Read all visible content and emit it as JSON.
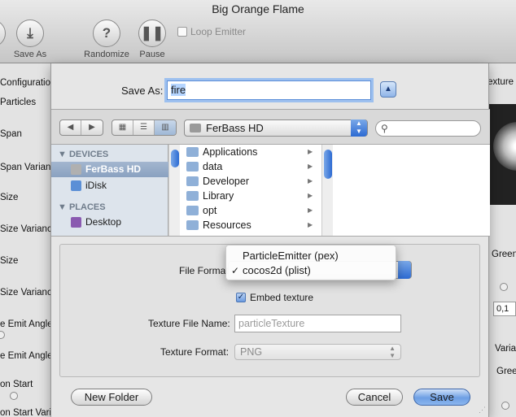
{
  "window": {
    "title": "Big Orange Flame"
  },
  "toolbar": {
    "save_as": "Save As",
    "randomize": "Randomize",
    "pause": "Pause",
    "loop_emitter": "Loop Emitter"
  },
  "background": {
    "left_labels": [
      "Configuration",
      "Particles",
      "Span",
      "Span Variance",
      "Size",
      "Size Variance",
      "Size",
      "Size Variance",
      "e Emit Angle",
      "e Emit Angle",
      "on Start",
      "on Start Varia"
    ],
    "right_labels": {
      "texture": "Particle Texture",
      "green_top": "Green",
      "value": "0,1",
      "variance": "Variance",
      "green_bottom": "Green"
    }
  },
  "sheet": {
    "save_as_label": "Save As:",
    "filename": "fire",
    "location": "FerBass HD",
    "sidebar": {
      "devices_heading": "DEVICES",
      "places_heading": "PLACES",
      "items": [
        {
          "label": "FerBass HD",
          "icon": "hard-drive-icon",
          "selected": true
        },
        {
          "label": "iDisk",
          "icon": "idisk-icon",
          "selected": false
        },
        {
          "label": "Desktop",
          "icon": "desktop-icon",
          "selected": false
        }
      ]
    },
    "files": [
      {
        "name": "Applications",
        "icon": "applications-folder-icon"
      },
      {
        "name": "data",
        "icon": "folder-icon"
      },
      {
        "name": "Developer",
        "icon": "developer-folder-icon"
      },
      {
        "name": "Library",
        "icon": "library-folder-icon"
      },
      {
        "name": "opt",
        "icon": "folder-icon"
      },
      {
        "name": "Resources",
        "icon": "folder-icon"
      }
    ],
    "options": {
      "file_format_label": "File Format:",
      "format_options": [
        "ParticleEmitter (pex)",
        "cocos2d (plist)"
      ],
      "format_selected": "cocos2d (plist)",
      "embed_texture_label": "Embed texture",
      "embed_texture_checked": true,
      "texture_file_name_label": "Texture File Name:",
      "texture_file_name_placeholder": "particleTexture",
      "texture_format_label": "Texture Format:",
      "texture_format_value": "PNG"
    },
    "buttons": {
      "new_folder": "New Folder",
      "cancel": "Cancel",
      "save": "Save"
    }
  }
}
